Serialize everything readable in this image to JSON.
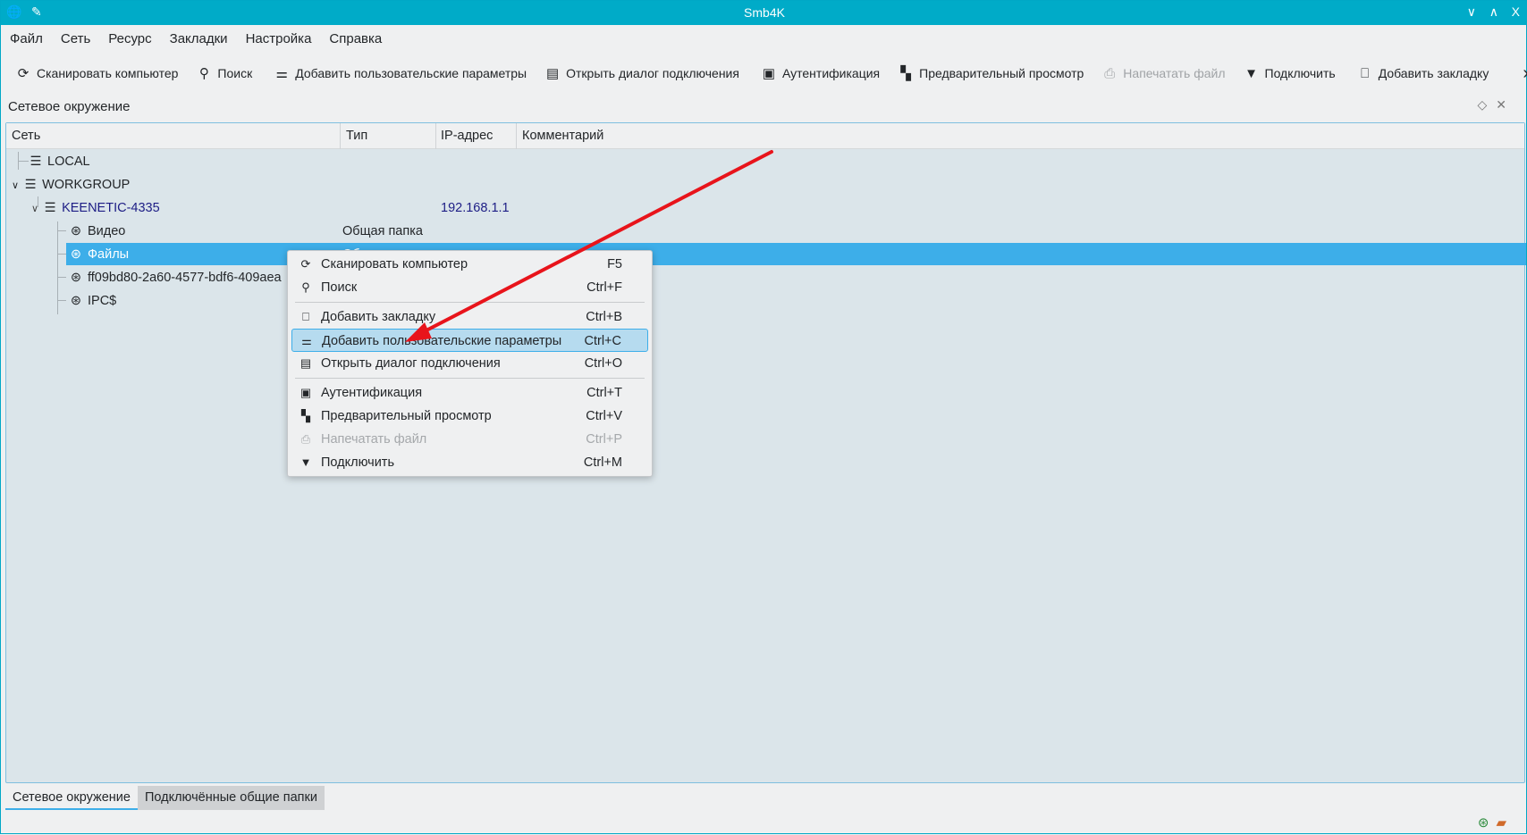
{
  "window": {
    "title": "Smb4K",
    "controls": {
      "minimize": "∨",
      "maximize": "∧",
      "close": "X"
    }
  },
  "menubar": [
    "Файл",
    "Сеть",
    "Ресурс",
    "Закладки",
    "Настройка",
    "Справка"
  ],
  "toolbar": {
    "scan": "Сканировать компьютер",
    "search": "Поиск",
    "custom": "Добавить пользовательские параметры",
    "open_dialog": "Открыть диалог подключения",
    "auth": "Аутентификация",
    "preview": "Предварительный просмотр",
    "print": "Напечатать файл",
    "mount": "Подключить",
    "bookmark": "Добавить закладку"
  },
  "dock": {
    "title": "Сетевое окружение"
  },
  "columns": [
    "Сеть",
    "Тип",
    "IP-адрес",
    "Комментарий"
  ],
  "tree": [
    {
      "name": "LOCAL",
      "type": "",
      "ip": ""
    },
    {
      "name": "WORKGROUP",
      "type": "",
      "ip": ""
    },
    {
      "name": "KEENETIC-4335",
      "type": "",
      "ip": "192.168.1.1"
    },
    {
      "name": "Видео",
      "type": "Общая папка",
      "ip": ""
    },
    {
      "name": "Файлы",
      "type": "Общая папка",
      "ip": ""
    },
    {
      "name": "ff09bd80-2a60-4577-bdf6-409aea",
      "type": "",
      "ip": ""
    },
    {
      "name": "IPC$",
      "type": "",
      "ip": ""
    }
  ],
  "context_menu": [
    {
      "label": "Сканировать компьютер",
      "shortcut": "F5"
    },
    {
      "label": "Поиск",
      "shortcut": "Ctrl+F"
    },
    {
      "label": "Добавить закладку",
      "shortcut": "Ctrl+B"
    },
    {
      "label": "Добавить пользовательские параметры",
      "shortcut": "Ctrl+C"
    },
    {
      "label": "Открыть диалог подключения",
      "shortcut": "Ctrl+O"
    },
    {
      "label": "Аутентификация",
      "shortcut": "Ctrl+T"
    },
    {
      "label": "Предварительный просмотр",
      "shortcut": "Ctrl+V"
    },
    {
      "label": "Напечатать файл",
      "shortcut": "Ctrl+P"
    },
    {
      "label": "Подключить",
      "shortcut": "Ctrl+M"
    }
  ],
  "tabs": [
    "Сетевое окружение",
    "Подключённые общие папки"
  ],
  "colors": {
    "titlebar": "#00abc8",
    "selection": "#3daee9",
    "arrow": "#e8141b"
  }
}
